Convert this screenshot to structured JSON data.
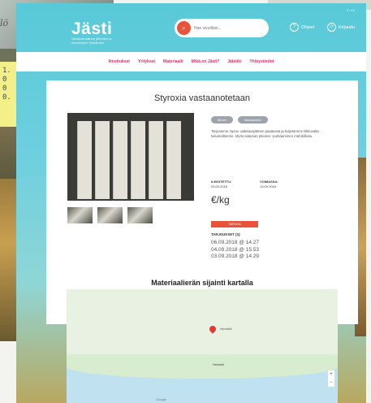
{
  "background": {
    "note_lines": [
      "1.",
      "0",
      "0",
      "0."
    ],
    "handwritten": "lö"
  },
  "header": {
    "logo": "Jästi",
    "tagline": "Vaitakunnallinen jätteiden ja sivuvirtojen Verkalusto",
    "search_placeholder": "Hae sivuiltäsi...",
    "links": {
      "offers": "Ohjeet",
      "login": "Kirjaudu"
    },
    "lang": "fi / en"
  },
  "nav": [
    "Ilmoitukset",
    "Yritykset",
    "Materiaalit",
    "Mikä on Jästi?",
    "Jätetiki",
    "Yhteystiedot"
  ],
  "listing": {
    "title": "Styroxia vastaanotetaan",
    "badges": [
      "Muovi",
      "Vastaanotto"
    ],
    "description": "Tarjoamme styrox -pakkausjätteen paalausta ja kuljetamme liikkuvalta kalustollamme. Myös sataman pikusvo -purkaaminen mahdollista.",
    "published_label": "ILMOITETTU:",
    "published": "03.09.2018",
    "expires_label": "VOIMASSA:",
    "expires": "13.09.2018",
    "price": "€/kg",
    "offer_button": "TARJOA",
    "offers_label": "TARJOUKSET (3):",
    "offers": [
      "06.09.2018 @ 14.27",
      "04.09.2018 @ 15.53",
      "03.09.2018 @ 14.29"
    ]
  },
  "map": {
    "title": "Materiaalierän sijainti kartalla",
    "pin_label": "Hyvinkää",
    "city": "Helsinki",
    "zoom_in": "+",
    "zoom_out": "−",
    "brand": "Google"
  }
}
